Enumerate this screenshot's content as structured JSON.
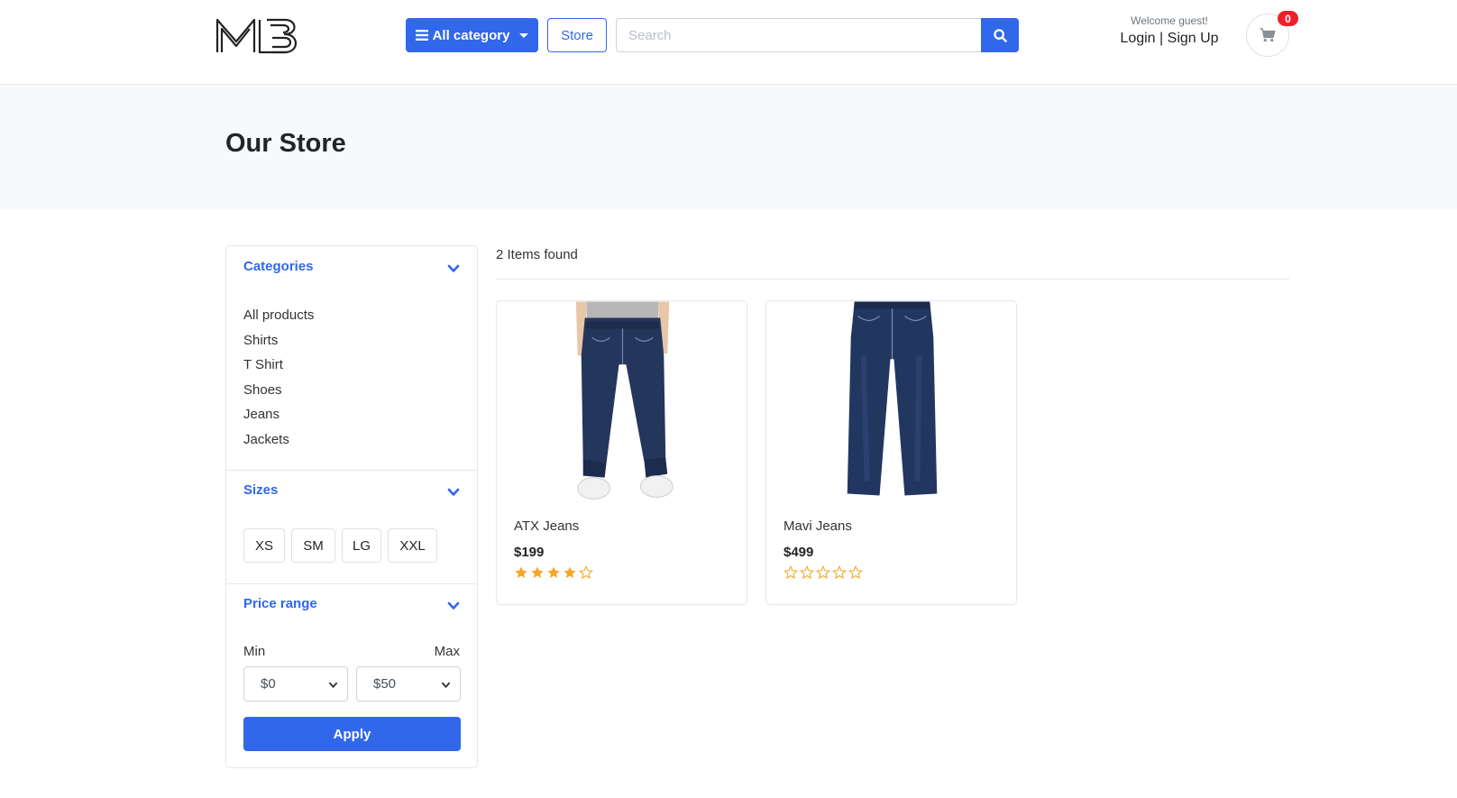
{
  "header": {
    "logo_text": "MB",
    "category_button": "All category",
    "store_button": "Store",
    "search_placeholder": "Search",
    "welcome": "Welcome guest!",
    "login": "Login",
    "separator": "|",
    "signup": "Sign Up",
    "cart_count": "0"
  },
  "page": {
    "title": "Our Store"
  },
  "filters": {
    "categories": {
      "title": "Categories",
      "items": [
        "All products",
        "Shirts",
        "T Shirt",
        "Shoes",
        "Jeans",
        "Jackets"
      ]
    },
    "sizes": {
      "title": "Sizes",
      "items": [
        "XS",
        "SM",
        "LG",
        "XXL"
      ]
    },
    "price": {
      "title": "Price range",
      "min_label": "Min",
      "max_label": "Max",
      "min_value": "$0",
      "max_value": "$50",
      "apply": "Apply"
    }
  },
  "results": {
    "count_text": "2 Items found",
    "products": [
      {
        "name": "ATX Jeans",
        "price": "$199",
        "rating": 4,
        "max_rating": 5
      },
      {
        "name": "Mavi Jeans",
        "price": "$499",
        "rating": 0,
        "max_rating": 5
      }
    ]
  },
  "colors": {
    "primary": "#3167eb",
    "star": "#f5a623",
    "badge": "#f31e2b"
  }
}
